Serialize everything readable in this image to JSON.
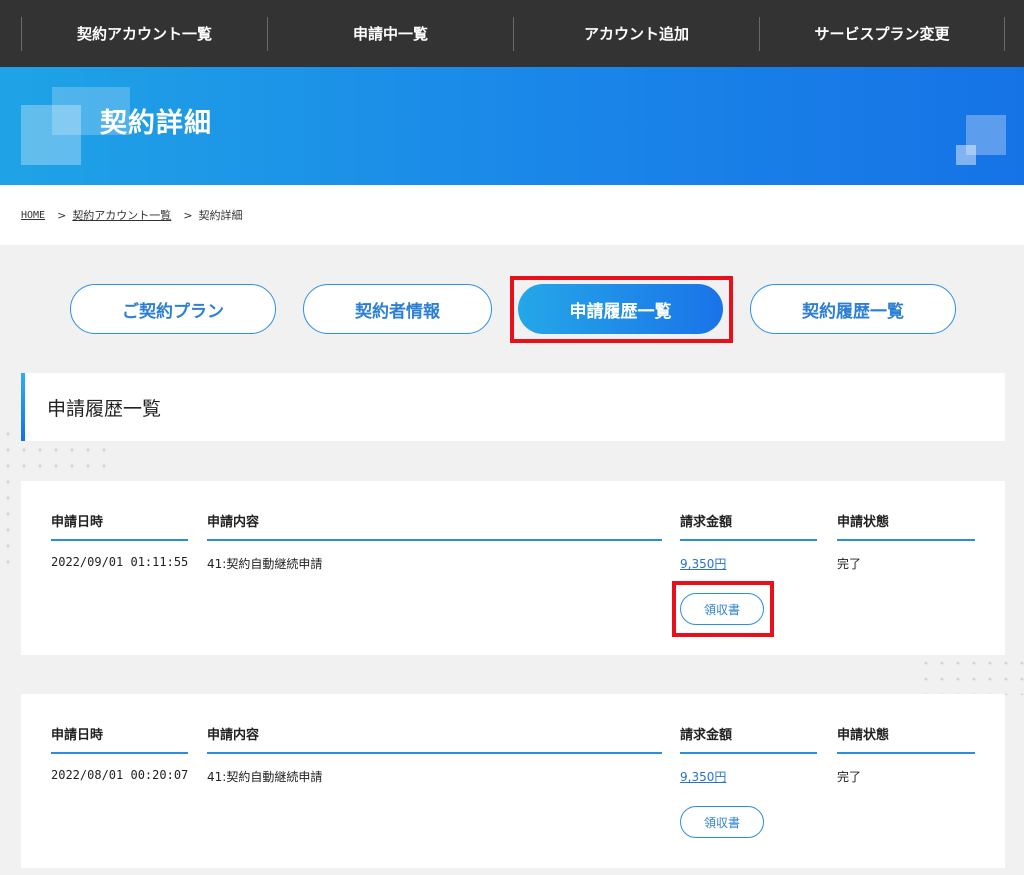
{
  "nav": {
    "items": [
      {
        "label": "契約アカウント一覧"
      },
      {
        "label": "申請中一覧"
      },
      {
        "label": "アカウント追加"
      },
      {
        "label": "サービスプラン変更"
      }
    ]
  },
  "hero": {
    "title": "契約詳細"
  },
  "breadcrumb": {
    "home": "HOME",
    "sep": ">",
    "accounts": "契約アカウント一覧",
    "current": "契約詳細"
  },
  "tabs": [
    {
      "label": "ご契約プラン",
      "active": false
    },
    {
      "label": "契約者情報",
      "active": false
    },
    {
      "label": "申請履歴一覧",
      "active": true
    },
    {
      "label": "契約履歴一覧",
      "active": false
    }
  ],
  "section": {
    "title": "申請履歴一覧"
  },
  "table": {
    "headers": {
      "date": "申請日時",
      "content": "申請内容",
      "amount": "請求金額",
      "status": "申請状態"
    },
    "rows": [
      {
        "date": "2022/09/01 01:11:55",
        "content": "41:契約自動継続申請",
        "amount": "9,350円",
        "status": "完了",
        "receipt": "領収書"
      },
      {
        "date": "2022/08/01 00:20:07",
        "content": "41:契約自動継続申請",
        "amount": "9,350円",
        "status": "完了",
        "receipt": "領収書"
      }
    ]
  },
  "colors": {
    "accent": "#1a86e8",
    "highlight": "#e8101a",
    "nav_bg": "#333333"
  }
}
